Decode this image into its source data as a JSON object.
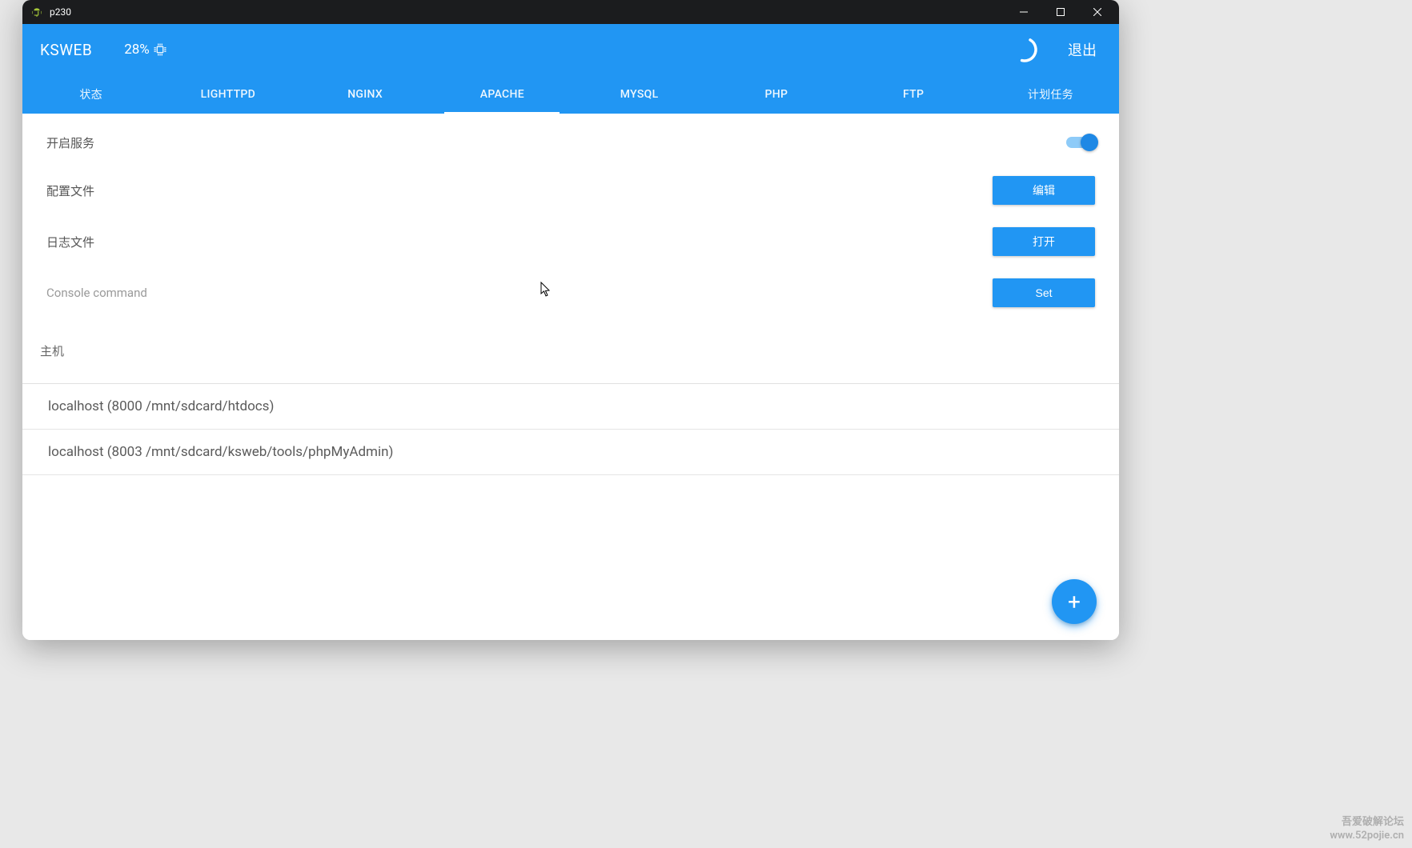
{
  "titlebar": {
    "title": "p230",
    "controls": {
      "minimize": "—",
      "maximize": "▢",
      "close": "✕"
    }
  },
  "header": {
    "brand": "KSWEB",
    "cpu_percent": "28%",
    "logout_label": "退出"
  },
  "tabs": [
    {
      "label": "状态",
      "active": false
    },
    {
      "label": "LIGHTTPD",
      "active": false
    },
    {
      "label": "NGINX",
      "active": false
    },
    {
      "label": "APACHE",
      "active": true
    },
    {
      "label": "MYSQL",
      "active": false
    },
    {
      "label": "PHP",
      "active": false
    },
    {
      "label": "FTP",
      "active": false
    },
    {
      "label": "计划任务",
      "active": false
    }
  ],
  "settings": {
    "enable_service": {
      "label": "开启服务",
      "value": true
    },
    "config_file": {
      "label": "配置文件",
      "button": "编辑"
    },
    "log_file": {
      "label": "日志文件",
      "button": "打开"
    },
    "console_command": {
      "label": "Console command",
      "button": "Set"
    }
  },
  "hosts_section_title": "主机",
  "hosts": [
    {
      "text": "localhost (8000 /mnt/sdcard/htdocs)"
    },
    {
      "text": "localhost (8003 /mnt/sdcard/ksweb/tools/phpMyAdmin)"
    }
  ],
  "fab_label": "+",
  "watermark": {
    "line1": "吾爱破解论坛",
    "line2": "www.52pojie.cn"
  }
}
